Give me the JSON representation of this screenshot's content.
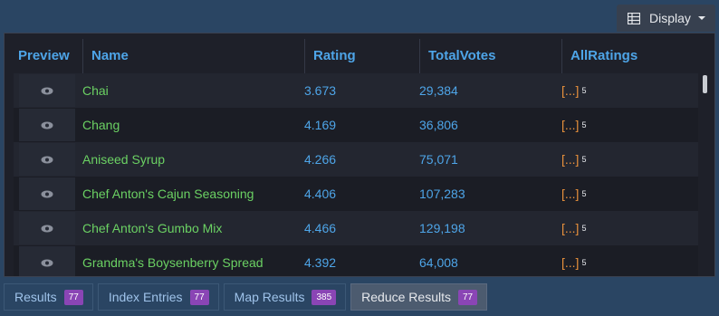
{
  "toolbar": {
    "display_label": "Display"
  },
  "table": {
    "columns": [
      "Preview",
      "Name",
      "Rating",
      "TotalVotes",
      "AllRatings"
    ],
    "rows": [
      {
        "name": "Chai",
        "rating": "3.673",
        "votes": "29,384",
        "all": "[...]",
        "count": "5"
      },
      {
        "name": "Chang",
        "rating": "4.169",
        "votes": "36,806",
        "all": "[...]",
        "count": "5"
      },
      {
        "name": "Aniseed Syrup",
        "rating": "4.266",
        "votes": "75,071",
        "all": "[...]",
        "count": "5"
      },
      {
        "name": "Chef Anton's Cajun Seasoning",
        "rating": "4.406",
        "votes": "107,283",
        "all": "[...]",
        "count": "5"
      },
      {
        "name": "Chef Anton's Gumbo Mix",
        "rating": "4.466",
        "votes": "129,198",
        "all": "[...]",
        "count": "5"
      },
      {
        "name": "Grandma's Boysenberry Spread",
        "rating": "4.392",
        "votes": "64,008",
        "all": "[...]",
        "count": "5"
      }
    ]
  },
  "tabs": [
    {
      "label": "Results",
      "count": "77"
    },
    {
      "label": "Index Entries",
      "count": "77"
    },
    {
      "label": "Map Results",
      "count": "385"
    },
    {
      "label": "Reduce Results",
      "count": "77"
    }
  ],
  "colors": {
    "accent": "#4ea5e8",
    "name": "#6bd163",
    "array": "#e8913c",
    "badge": "#8a45b5"
  }
}
